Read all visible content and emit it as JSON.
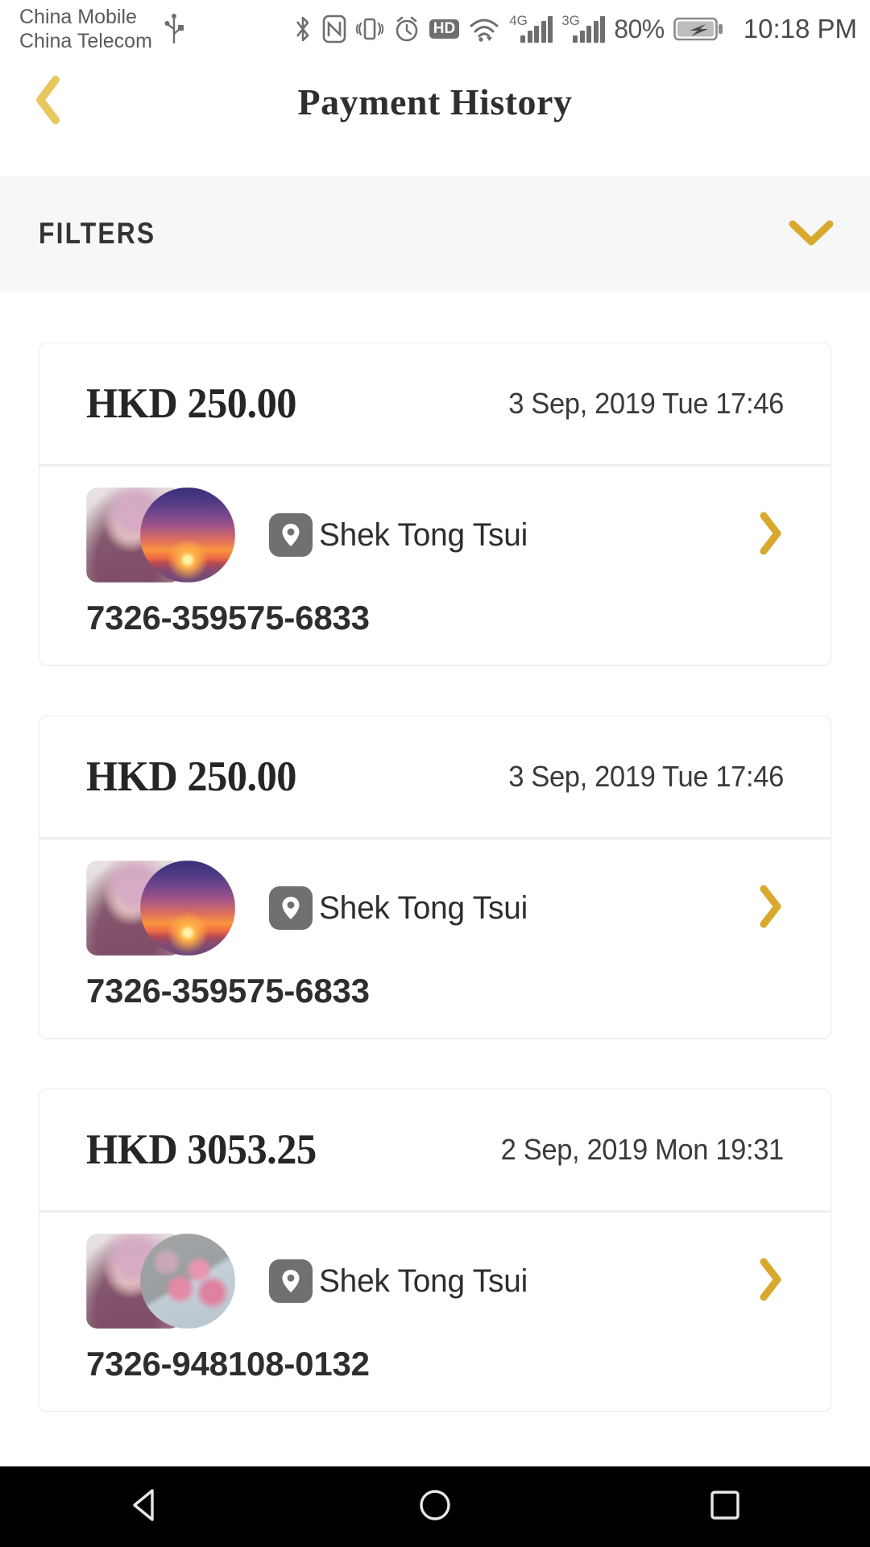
{
  "statusbar": {
    "carrier_line1": "China Mobile",
    "carrier_line2": "China Telecom",
    "usb_icon": "usb-icon",
    "bluetooth_icon": "bluetooth-icon",
    "nfc_icon": "nfc-icon",
    "vibrate_icon": "vibrate-icon",
    "alarm_icon": "alarm-icon",
    "hd_label": "HD",
    "wifi_icon": "wifi-icon",
    "sim1_network": "4G",
    "sim2_network": "3G",
    "battery_percent": "80%",
    "battery_icon": "battery-charging-icon",
    "time": "10:18 PM"
  },
  "header": {
    "back_icon": "chevron-left-icon",
    "title": "Payment History"
  },
  "filters": {
    "label": "FILTERS",
    "expand_icon": "chevron-down-icon"
  },
  "colors": {
    "accent": "#D9A92E",
    "accent_light": "#E8C75E",
    "text": "#2e2e2e",
    "filters_bg": "#f7f7f7",
    "divider": "#efefef",
    "pin_badge": "#707070"
  },
  "payments": [
    {
      "amount": "HKD 250.00",
      "datetime": "3 Sep, 2019 Tue 17:46",
      "location": "Shek Tong Tsui",
      "card_number": "7326-359575-6833",
      "avatar_square": "person-photo",
      "avatar_circle": "sunset-photo",
      "location_icon": "location-pin-icon",
      "detail_icon": "chevron-right-icon"
    },
    {
      "amount": "HKD 250.00",
      "datetime": "3 Sep, 2019 Tue 17:46",
      "location": "Shek Tong Tsui",
      "card_number": "7326-359575-6833",
      "avatar_square": "person-photo",
      "avatar_circle": "sunset-photo",
      "location_icon": "location-pin-icon",
      "detail_icon": "chevron-right-icon"
    },
    {
      "amount": "HKD 3053.25",
      "datetime": "2 Sep, 2019 Mon 19:31",
      "location": "Shek Tong Tsui",
      "card_number": "7326-948108-0132",
      "avatar_square": "person-photo",
      "avatar_circle": "cherry-blossom-photo",
      "location_icon": "location-pin-icon",
      "detail_icon": "chevron-right-icon"
    }
  ],
  "navbar": {
    "back_icon": "nav-back-triangle-icon",
    "home_icon": "nav-home-circle-icon",
    "recents_icon": "nav-recents-square-icon"
  }
}
